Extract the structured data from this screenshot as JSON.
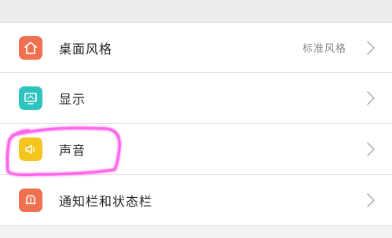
{
  "settings": {
    "items": [
      {
        "label": "桌面风格",
        "value": "标准风格",
        "icon": "home-icon",
        "color": "#f0704f"
      },
      {
        "label": "显示",
        "value": "",
        "icon": "monitor-icon",
        "color": "#2ec3bd"
      },
      {
        "label": "声音",
        "value": "",
        "icon": "speaker-icon",
        "color": "#f5c51d"
      },
      {
        "label": "通知栏和状态栏",
        "value": "",
        "icon": "bell-icon",
        "color": "#f0704f"
      }
    ]
  },
  "highlight": {
    "color": "#ff5ee8"
  }
}
